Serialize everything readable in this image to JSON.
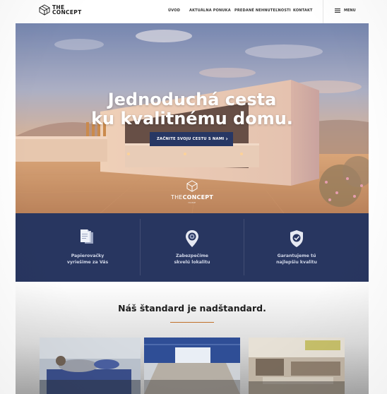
{
  "header": {
    "logo": {
      "line1": "THE",
      "line2": "CONCEPT"
    },
    "nav": [
      {
        "label": "ÚVOD"
      },
      {
        "label": "AKTUÁLNA PONUKA"
      },
      {
        "label": "PREDANÉ NEHNUTEĽNOSTI"
      },
      {
        "label": "KONTAKT"
      }
    ],
    "menu": {
      "label": "MENU",
      "icon": "hamburger-icon"
    }
  },
  "hero": {
    "title_line1": "Jednoduchá cesta",
    "title_line2": "ku kvalitnému domu.",
    "cta_label": "ZAČNITE SVOJU CESTU S NAMI",
    "cta_icon": "chevron-right-icon",
    "brand": {
      "the": "THE",
      "concept": "CONCEPT",
      "sub": "HOME"
    }
  },
  "features": [
    {
      "icon": "documents-icon",
      "line1": "Papierovačky",
      "line2": "vyriešime za Vás"
    },
    {
      "icon": "location-pin-icon",
      "line1": "Zabezpečíme",
      "line2": "skvelú lokalitu"
    },
    {
      "icon": "shield-check-icon",
      "line1": "Garantujeme tú",
      "line2": "najlepšiu kvalitu"
    }
  ],
  "standard": {
    "title": "Náš štandard je nadštandard."
  },
  "colors": {
    "navy": "#283660",
    "cta": "#273764",
    "accent_line": "#c0702a"
  }
}
